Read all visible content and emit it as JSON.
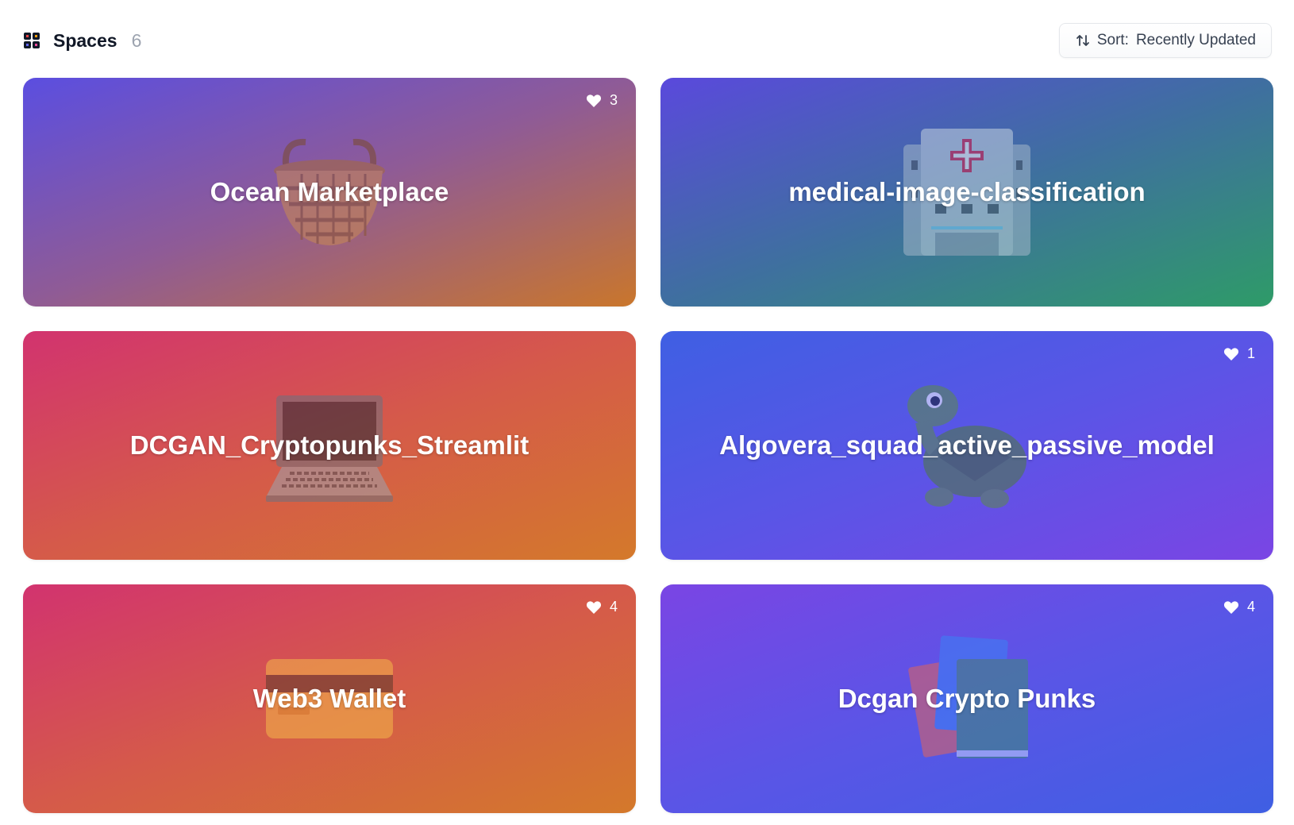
{
  "header": {
    "icon": "spaces-grid-icon",
    "title": "Spaces",
    "count": "6",
    "sort": {
      "icon": "sort-arrows-icon",
      "label": "Sort:",
      "value": "Recently Updated"
    }
  },
  "cards": [
    {
      "title": "Ocean Marketplace",
      "likes": "3",
      "emoji_icon": "basket-icon",
      "gradient": [
        "#5b4ee0",
        "#8f5b96",
        "#c9762c"
      ]
    },
    {
      "title": "medical-image-classification",
      "likes": "",
      "emoji_icon": "hospital-icon",
      "gradient": [
        "#5a49dc",
        "#3f6fa0",
        "#2e9b68"
      ]
    },
    {
      "title": "DCGAN_Cryptopunks_Streamlit",
      "likes": "",
      "emoji_icon": "laptop-icon",
      "gradient": [
        "#d2336f",
        "#d55a4a",
        "#d4792b"
      ]
    },
    {
      "title": "Algovera_squad_active_passive_model",
      "likes": "1",
      "emoji_icon": "turtle-icon",
      "gradient": [
        "#3f5fe3",
        "#5a55e6",
        "#7a45e4"
      ]
    },
    {
      "title": "Web3 Wallet",
      "likes": "4",
      "emoji_icon": "credit-card-icon",
      "gradient": [
        "#d2336f",
        "#d55a4a",
        "#d4792b"
      ]
    },
    {
      "title": "Dcgan Crypto Punks",
      "likes": "4",
      "emoji_icon": "books-icon",
      "gradient": [
        "#7a45e4",
        "#5a55e6",
        "#3f5fe3"
      ]
    }
  ]
}
